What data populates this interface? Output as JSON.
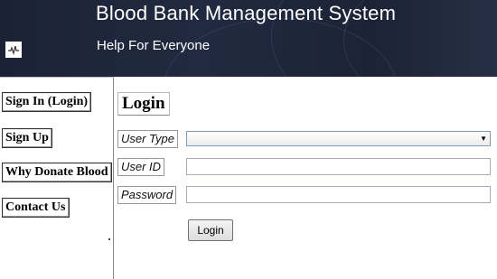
{
  "header": {
    "title": "Blood Bank Management System",
    "subtitle": "Help For Everyone",
    "logo_icon": "heartbeat-icon"
  },
  "sidebar": {
    "items": [
      {
        "label": "Sign In (Login)"
      },
      {
        "label": "Sign Up"
      },
      {
        "label": "Why Donate Blood"
      },
      {
        "label": "Contact Us"
      }
    ]
  },
  "login": {
    "heading": "Login",
    "user_type_label": "User Type",
    "user_type_value": "",
    "user_id_label": "User ID",
    "user_id_value": "",
    "password_label": "Password",
    "password_value": "",
    "submit_label": "Login"
  },
  "colors": {
    "header_bg": "#1f2739",
    "header_text": "#ffffff"
  }
}
